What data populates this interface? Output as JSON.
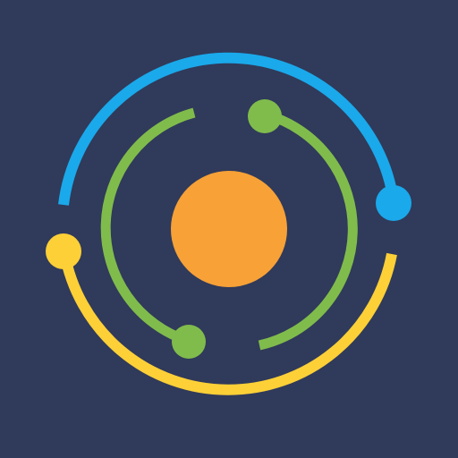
{
  "icon": {
    "name": "orbit-logo-icon",
    "colors": {
      "background": "#303A5A",
      "core": "#F7A137",
      "outer_orbit": "#1AA9EB",
      "lower_orbit": "#FDD037",
      "inner_orbit": "#80BC4C"
    }
  }
}
